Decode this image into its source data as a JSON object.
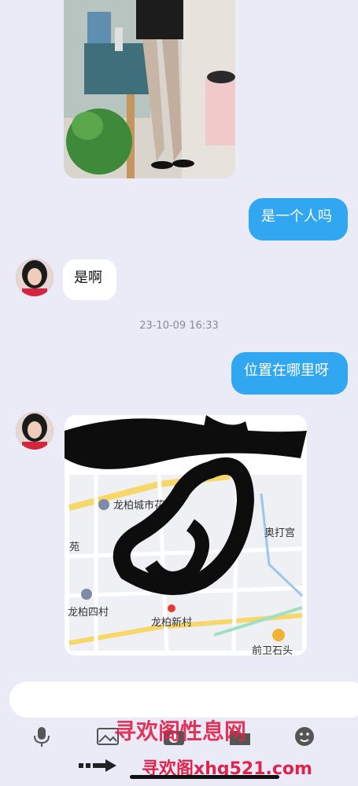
{
  "messages": {
    "out_1": "是一个人吗",
    "in_1": "是啊",
    "timestamp": "23-10-09 16:33",
    "out_2": "位置在哪里呀"
  },
  "map": {
    "labels": [
      "龙柏城市花园",
      "奥打宫",
      "苑",
      "龙柏四村",
      "龙柏新村",
      "前卫石头"
    ]
  },
  "input": {
    "placeholder": ""
  },
  "icons": [
    "microphone-icon",
    "image-icon",
    "camera-icon",
    "folder-icon",
    "emoji-icon"
  ],
  "watermark": {
    "line1": "寻欢阁性息网",
    "line2": "寻欢阁xhg521.com"
  },
  "colors": {
    "outgoing_bubble": "#31a7f2",
    "background": "#ebebf7",
    "watermark": "#e0234b"
  }
}
